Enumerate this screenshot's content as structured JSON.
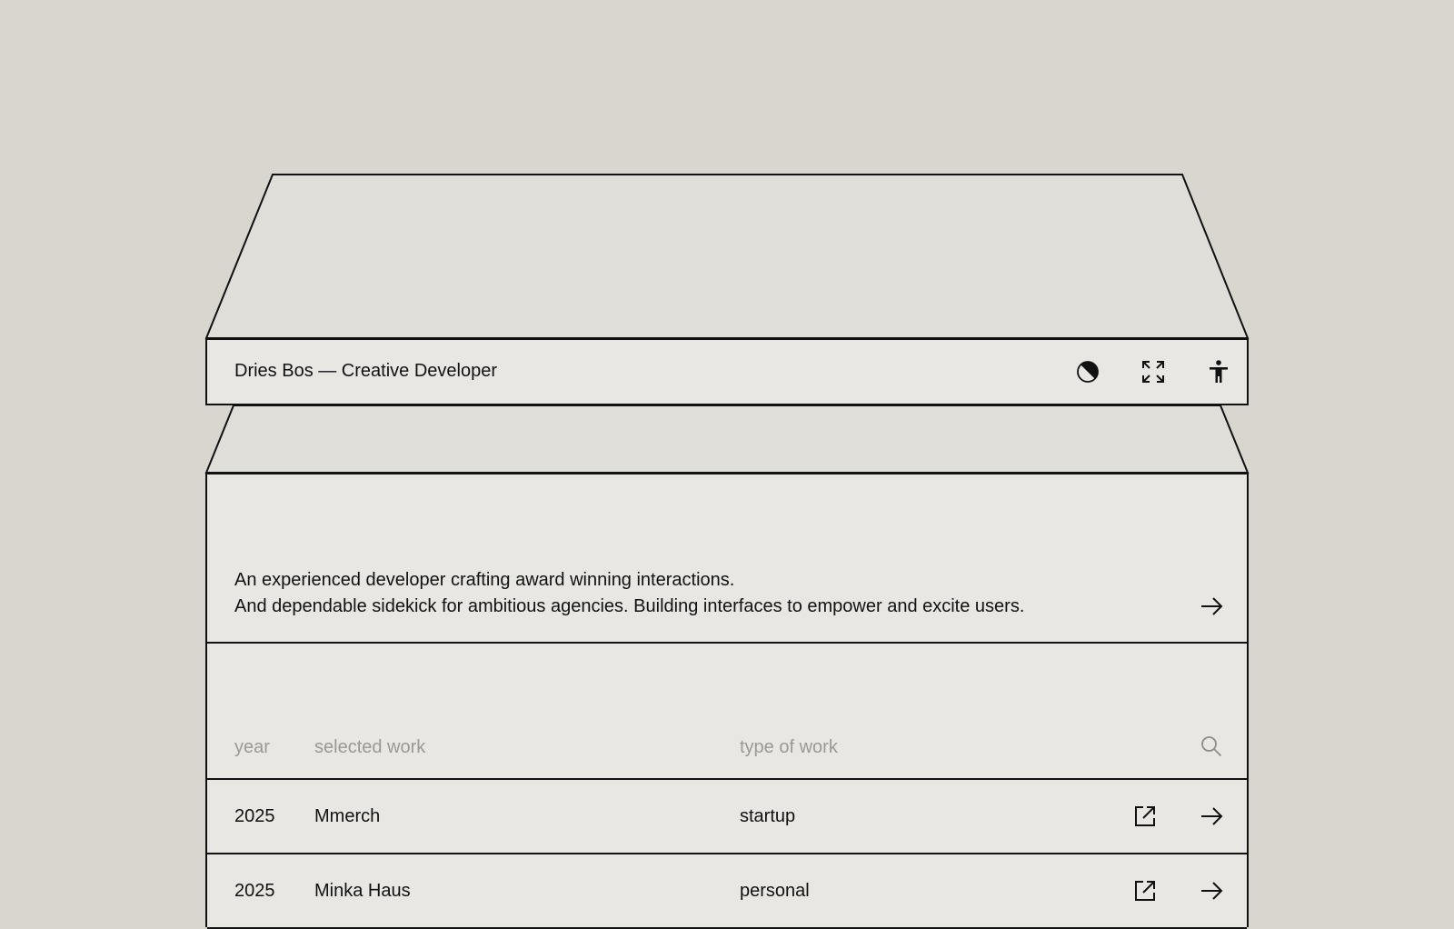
{
  "colors": {
    "background": "#d8d6cf",
    "surface": "#e8e7e3",
    "surface_dim": "#dfded9",
    "ink": "#111111",
    "muted": "#9a9995"
  },
  "header": {
    "title": "Dries Bos — Creative Developer",
    "icons": [
      "contrast-icon",
      "fullscreen-icon",
      "accessibility-icon"
    ]
  },
  "intro": {
    "line1": "An experienced developer crafting award winning interactions.",
    "line2": "And dependable sidekick for ambitious agencies. Building interfaces to empower and excite users."
  },
  "work_table": {
    "columns": [
      "year",
      "selected work",
      "type of work"
    ],
    "rows": [
      {
        "year": "2025",
        "work": "Mmerch",
        "type": "startup"
      },
      {
        "year": "2025",
        "work": "Minka Haus",
        "type": "personal"
      }
    ]
  }
}
